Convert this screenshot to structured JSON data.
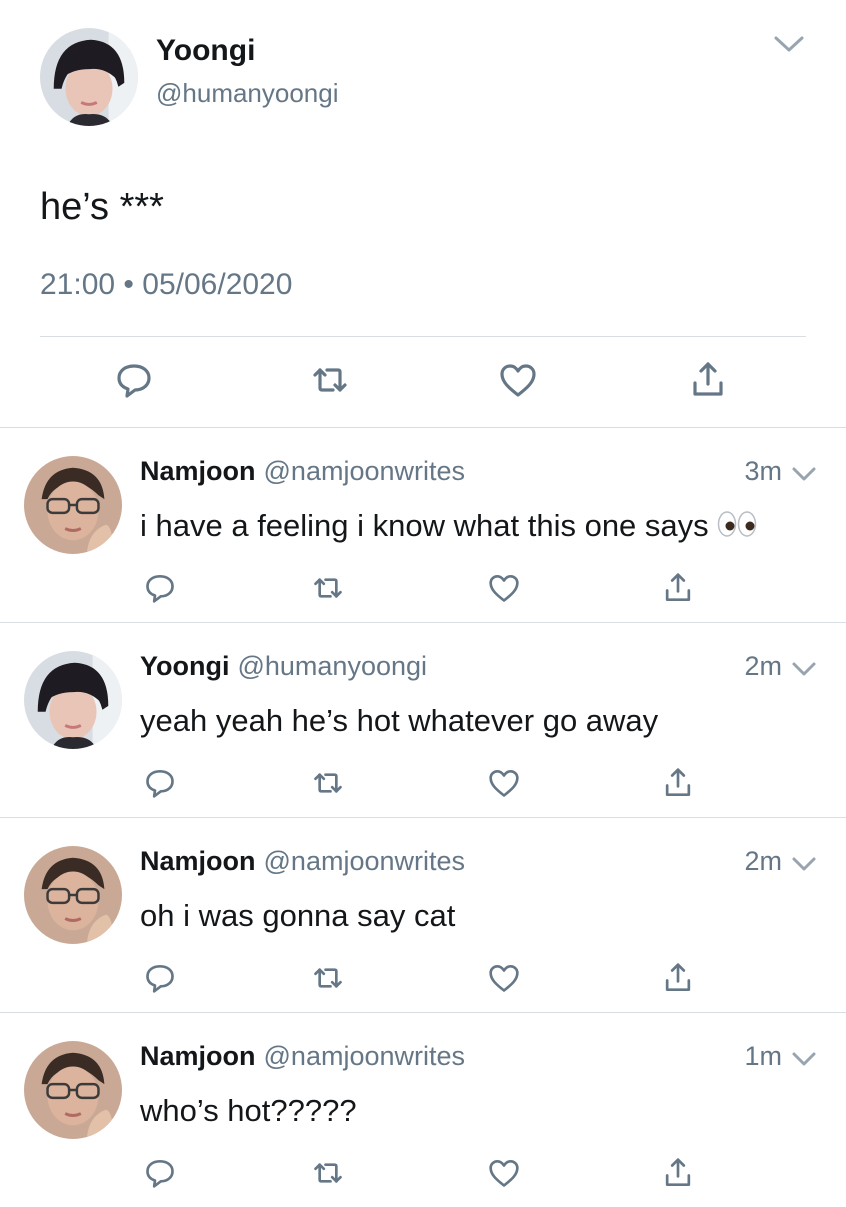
{
  "main_tweet": {
    "author_name": "Yoongi",
    "author_handle": "@humanyoongi",
    "text": "he’s ***",
    "time": "21:00",
    "separator": "•",
    "date": "05/06/2020",
    "icons": [
      "avatar",
      "chevron-down-icon",
      "reply-icon",
      "retweet-icon",
      "like-icon",
      "share-icon"
    ]
  },
  "replies": [
    {
      "author_name": "Namjoon",
      "author_handle": "@namjoonwrites",
      "time": "3m",
      "text": "i have a feeling i know what this one says",
      "emoji": "eyes-emoji"
    },
    {
      "author_name": "Yoongi",
      "author_handle": "@humanyoongi",
      "time": "2m",
      "text": "yeah yeah he’s hot whatever go away"
    },
    {
      "author_name": "Namjoon",
      "author_handle": "@namjoonwrites",
      "time": "2m",
      "text": "oh i was gonna say cat"
    },
    {
      "author_name": "Namjoon",
      "author_handle": "@namjoonwrites",
      "time": "1m",
      "text": "who’s hot?????"
    }
  ],
  "colors": {
    "primary_text": "#14171a",
    "secondary_text": "#657786",
    "icon": "#657786",
    "divider": "#d9dee2"
  }
}
